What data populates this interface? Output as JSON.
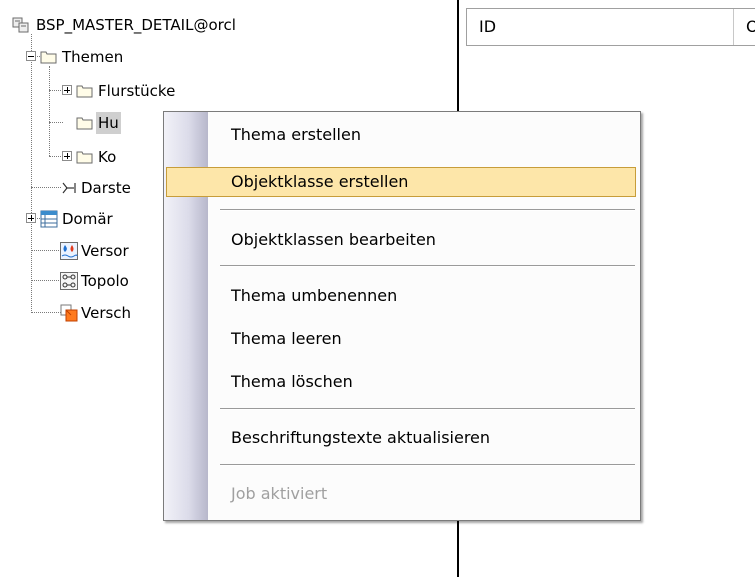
{
  "tree": {
    "root": {
      "label": "BSP_MASTER_DETAIL@orcl"
    },
    "themen": {
      "label": "Themen"
    },
    "themen_children": [
      {
        "label": "Flurstücke"
      },
      {
        "label": "Hu"
      },
      {
        "label": "Ko"
      }
    ],
    "siblings": [
      {
        "label": "Darste"
      },
      {
        "label": "Domär"
      },
      {
        "label": "Versor"
      },
      {
        "label": "Topolo"
      },
      {
        "label": "Versch"
      }
    ]
  },
  "grid": {
    "columns": [
      "ID",
      "Ol"
    ]
  },
  "context_menu": {
    "items": [
      {
        "label": "Thema erstellen",
        "state": "normal"
      },
      {
        "label": "Objektklasse erstellen",
        "state": "hover"
      },
      {
        "label": "Objektklassen bearbeiten",
        "state": "normal"
      },
      {
        "label": "Thema umbenennen",
        "state": "normal"
      },
      {
        "label": "Thema leeren",
        "state": "normal"
      },
      {
        "label": "Thema löschen",
        "state": "normal"
      },
      {
        "label": "Beschriftungstexte aktualisieren",
        "state": "normal"
      },
      {
        "label": "Job aktiviert",
        "state": "disabled"
      }
    ]
  },
  "colors": {
    "hover_fill": "#fde6a9",
    "hover_border": "#c79d3a",
    "disabled_text": "#a0a0a0",
    "folder_fill": "#fffce8",
    "folder_stroke": "#6b6b6b"
  }
}
